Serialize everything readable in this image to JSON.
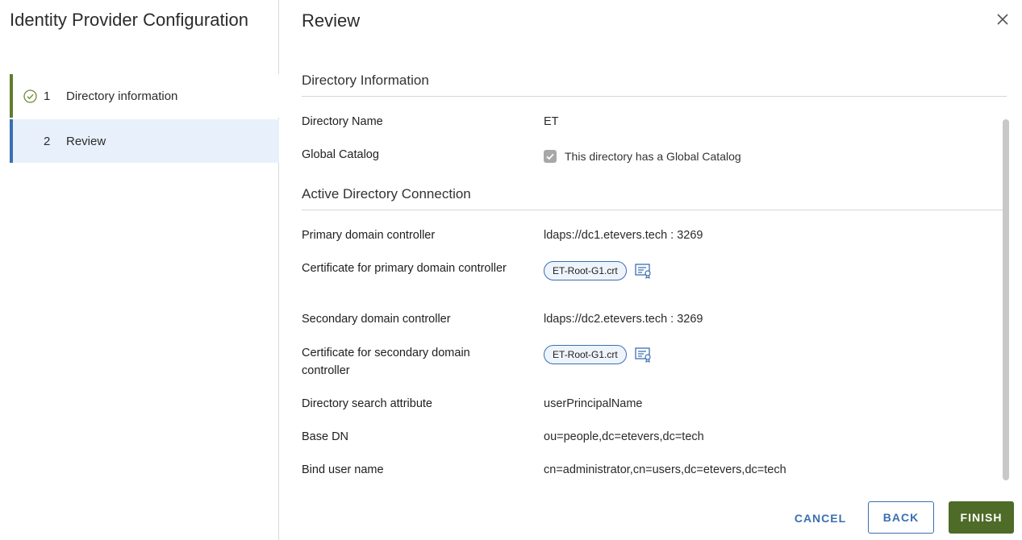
{
  "wizard": {
    "title": "Identity Provider Configuration",
    "steps": [
      {
        "number": "1",
        "label": "Directory information",
        "status": "completed"
      },
      {
        "number": "2",
        "label": "Review",
        "status": "active"
      }
    ]
  },
  "review": {
    "title": "Review",
    "sections": [
      {
        "heading": "Directory Information",
        "rows": [
          {
            "label": "Directory Name",
            "value": "ET"
          },
          {
            "label": "Global Catalog",
            "value": "This directory has a Global Catalog",
            "checked": true
          }
        ]
      },
      {
        "heading": "Active Directory Connection",
        "rows": [
          {
            "label": "Primary domain controller",
            "value": "ldaps://dc1.etevers.tech : 3269"
          },
          {
            "label": "Certificate for primary domain controller",
            "value": "ET-Root-G1.crt"
          },
          {
            "label": "Secondary domain controller",
            "value": "ldaps://dc2.etevers.tech : 3269"
          },
          {
            "label": "Certificate for secondary domain controller",
            "value": "ET-Root-G1.crt"
          },
          {
            "label": "Directory search attribute",
            "value": "userPrincipalName"
          },
          {
            "label": "Base DN",
            "value": "ou=people,dc=etevers,dc=tech"
          },
          {
            "label": "Bind user name",
            "value": "cn=administrator,cn=users,dc=etevers,dc=tech"
          }
        ]
      }
    ]
  },
  "footer": {
    "cancel_label": "CANCEL",
    "back_label": "BACK",
    "finish_label": "FINISH"
  },
  "colors": {
    "accent_green": "#4e6b27",
    "accent_blue": "#3a6fb0"
  },
  "icons": {
    "close": "close-icon",
    "step_complete": "check-circle-icon",
    "checkbox": "checkbox-checked-icon",
    "certificate": "certificate-icon"
  }
}
